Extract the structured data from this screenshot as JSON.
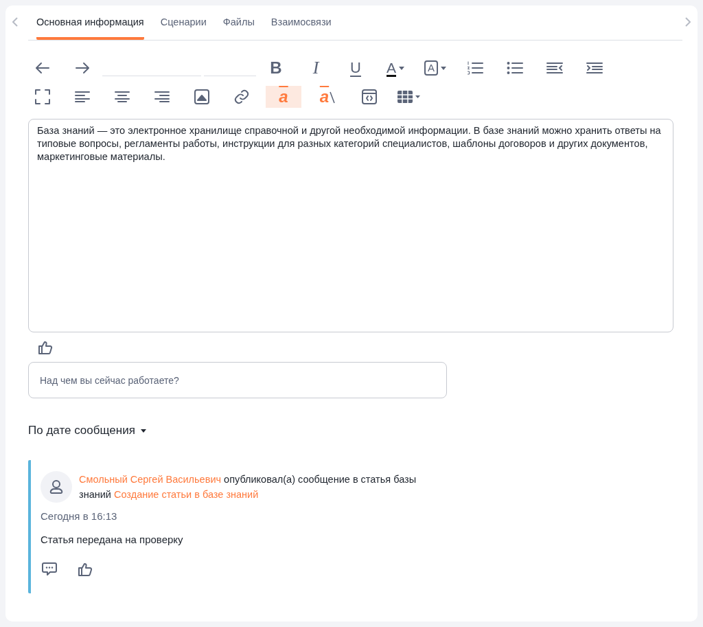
{
  "tabs": [
    {
      "label": "Основная информация",
      "selected": true
    },
    {
      "label": "Сценарии",
      "selected": false
    },
    {
      "label": "Файлы",
      "selected": false
    },
    {
      "label": "Взаимосвязи",
      "selected": false
    }
  ],
  "toolbar": {
    "rows": [
      [
        {
          "kind": "undo"
        },
        {
          "kind": "redo"
        },
        {
          "kind": "select-wide"
        },
        {
          "kind": "select-narrow"
        },
        {
          "kind": "bold",
          "label": "B"
        },
        {
          "kind": "italic",
          "label": "I"
        },
        {
          "kind": "underline",
          "label": "U"
        },
        {
          "kind": "font-color",
          "label": "A"
        },
        {
          "kind": "background-color",
          "label": "A"
        },
        {
          "kind": "ordered-list"
        },
        {
          "kind": "bullet-list"
        },
        {
          "kind": "outdent"
        },
        {
          "kind": "indent"
        }
      ],
      [
        {
          "kind": "fullscreen"
        },
        {
          "kind": "align-left"
        },
        {
          "kind": "align-center"
        },
        {
          "kind": "align-right"
        },
        {
          "kind": "image"
        },
        {
          "kind": "link"
        },
        {
          "kind": "overline",
          "label": "a",
          "active": true
        },
        {
          "kind": "clear-format",
          "label": "a",
          "active": false
        },
        {
          "kind": "code"
        },
        {
          "kind": "table"
        }
      ]
    ]
  },
  "editor": {
    "text": "База знаний — это электронное хранилище справочной и другой необходимой информации. В базе знаний можно хранить ответы на типовые вопросы, регламенты работы, инструкции для разных категорий специалистов, шаблоны договоров и других документов, маркетинговые материалы."
  },
  "post_field": {
    "placeholder": "Над чем вы сейчас работаете?"
  },
  "sort": {
    "label": "По дате сообщения"
  },
  "feed": [
    {
      "author": "Смольный Сергей Васильевич",
      "action": "опубликовал(а) сообщение в статья базы знаний",
      "article": "Создание статьи в базе знаний",
      "time": "Сегодня в 16:13",
      "message": "Статья передана на проверку"
    }
  ]
}
